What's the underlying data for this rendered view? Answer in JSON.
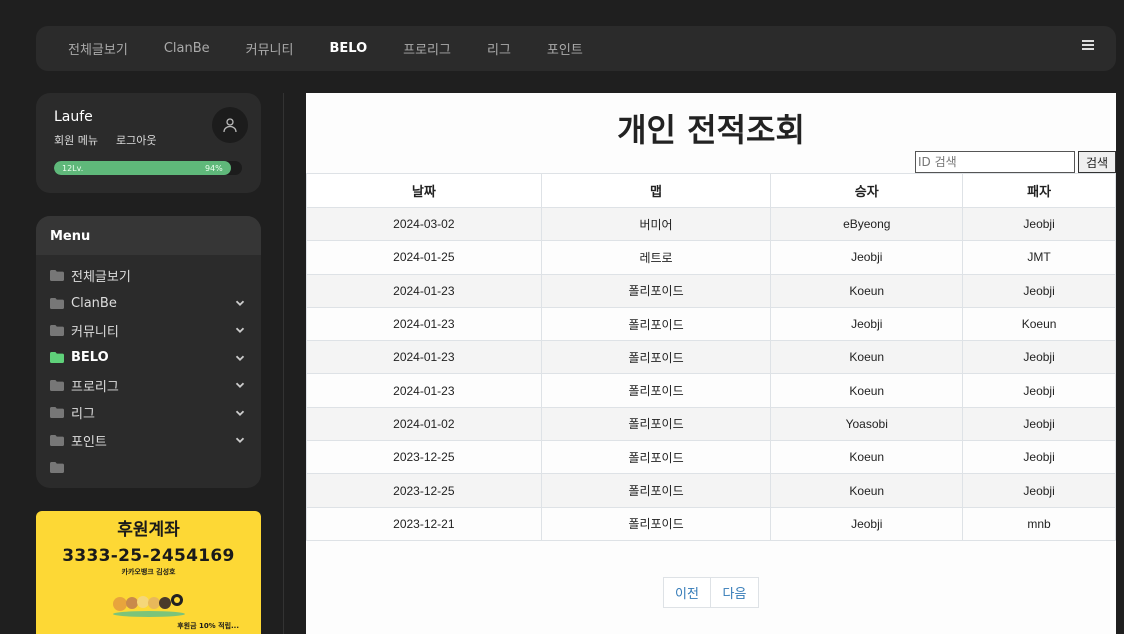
{
  "topnav": {
    "items": [
      {
        "label": "전체글보기"
      },
      {
        "label": "ClanBe"
      },
      {
        "label": "커뮤니티"
      },
      {
        "label": "BELO"
      },
      {
        "label": "프로리그"
      },
      {
        "label": "리그"
      },
      {
        "label": "포인트"
      }
    ],
    "active_index": 3
  },
  "user": {
    "name": "Laufe",
    "member_menu": "회원 메뉴",
    "logout": "로그아웃",
    "level_label": "12Lv.",
    "level_percent_label": "94%",
    "level_progress": 0.94
  },
  "menu": {
    "title": "Menu",
    "items": [
      {
        "label": "전체글보기",
        "chevron": false,
        "active": false
      },
      {
        "label": "ClanBe",
        "chevron": true,
        "active": false
      },
      {
        "label": "커뮤니티",
        "chevron": true,
        "active": false
      },
      {
        "label": "BELO",
        "chevron": true,
        "active": true
      },
      {
        "label": "프로리그",
        "chevron": true,
        "active": false
      },
      {
        "label": "리그",
        "chevron": true,
        "active": false
      },
      {
        "label": "포인트",
        "chevron": true,
        "active": false
      },
      {
        "label": "",
        "chevron": false,
        "active": false
      }
    ]
  },
  "banner": {
    "title": "후원계좌",
    "account": "3333-25-2454169",
    "bank": "카카오뱅크 김성호",
    "note": "후원금 10% 적립..."
  },
  "main": {
    "title": "개인 전적조회",
    "search_placeholder": "ID 검색",
    "search_button": "검색",
    "columns": [
      "날짜",
      "맵",
      "승자",
      "패자"
    ],
    "rows": [
      [
        "2024-03-02",
        "버미어",
        "eByeong",
        "Jeobji"
      ],
      [
        "2024-01-25",
        "레트로",
        "Jeobji",
        "JMT"
      ],
      [
        "2024-01-23",
        "폴리포이드",
        "Koeun",
        "Jeobji"
      ],
      [
        "2024-01-23",
        "폴리포이드",
        "Jeobji",
        "Koeun"
      ],
      [
        "2024-01-23",
        "폴리포이드",
        "Koeun",
        "Jeobji"
      ],
      [
        "2024-01-23",
        "폴리포이드",
        "Koeun",
        "Jeobji"
      ],
      [
        "2024-01-02",
        "폴리포이드",
        "Yoasobi",
        "Jeobji"
      ],
      [
        "2023-12-25",
        "폴리포이드",
        "Koeun",
        "Jeobji"
      ],
      [
        "2023-12-25",
        "폴리포이드",
        "Koeun",
        "Jeobji"
      ],
      [
        "2023-12-21",
        "폴리포이드",
        "Jeobji",
        "mnb"
      ]
    ],
    "prev_label": "이전",
    "next_label": "다음"
  },
  "colors": {
    "page_bg": "#1f1f1f",
    "card_bg": "#2b2b2b",
    "level_green": "#5fb87a",
    "active_folder": "#5fd17a",
    "banner_yellow": "#fdd835",
    "link_blue": "#337ab7"
  }
}
